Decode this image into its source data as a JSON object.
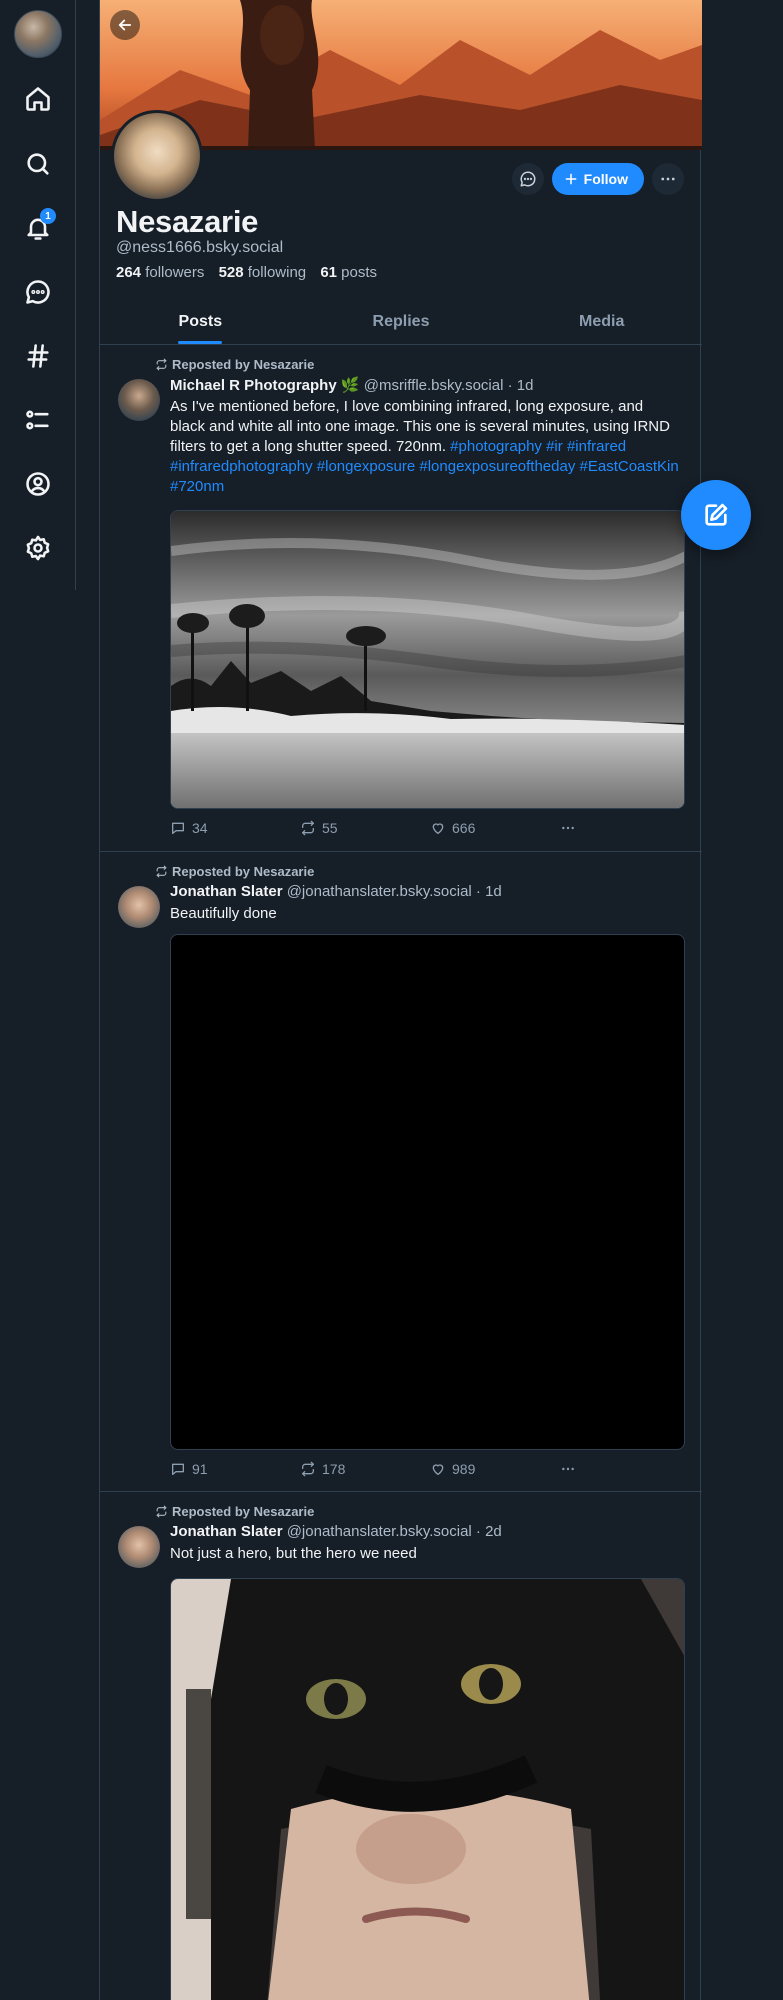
{
  "nav": {
    "notification_count": "1",
    "icons": [
      "home-icon",
      "search-icon",
      "bell-icon",
      "chat-icon",
      "hashtag-icon",
      "list-icon",
      "profile-icon",
      "gear-icon"
    ]
  },
  "profile": {
    "display_name": "Nesazarie",
    "handle": "@ness1666.bsky.social",
    "followers_count": "264",
    "followers_label": "followers",
    "following_count": "528",
    "following_label": "following",
    "posts_count": "61",
    "posts_label": "posts",
    "follow_label": "Follow"
  },
  "tabs": [
    {
      "label": "Posts",
      "active": true
    },
    {
      "label": "Replies",
      "active": false
    },
    {
      "label": "Media",
      "active": false
    }
  ],
  "posts": [
    {
      "repost_label": "Reposted by Nesazarie",
      "author": "Michael R Photography",
      "author_emoji": "🌿",
      "handle": "@msriffle.bsky.social",
      "time": "· 1d",
      "text": "As I've mentioned before, I love combining infrared, long exposure, and black and white all into one  image.  This one is several minutes, using IRND filters to get a long shutter speed.  720nm.",
      "tags": [
        "#photography",
        "#ir",
        "#infrared",
        "#infraredphotography",
        "#longexposure",
        "#longexposureoftheday",
        "#EastCoastKin",
        "#720nm"
      ],
      "replies": "34",
      "reposts": "55",
      "likes": "666"
    },
    {
      "repost_label": "Reposted by Nesazarie",
      "author": "Jonathan Slater",
      "handle": "@jonathanslater.bsky.social",
      "time": "· 1d",
      "text": "Beautifully done",
      "replies": "91",
      "reposts": "178",
      "likes": "989"
    },
    {
      "repost_label": "Reposted by Nesazarie",
      "author": "Jonathan Slater",
      "handle": "@jonathanslater.bsky.social",
      "time": "· 2d",
      "text": "Not just a hero, but the hero we need"
    }
  ],
  "colors": {
    "background": "#161e27",
    "accent": "#208bfe",
    "muted_text": "#aebbc9",
    "border": "#2e4052"
  }
}
